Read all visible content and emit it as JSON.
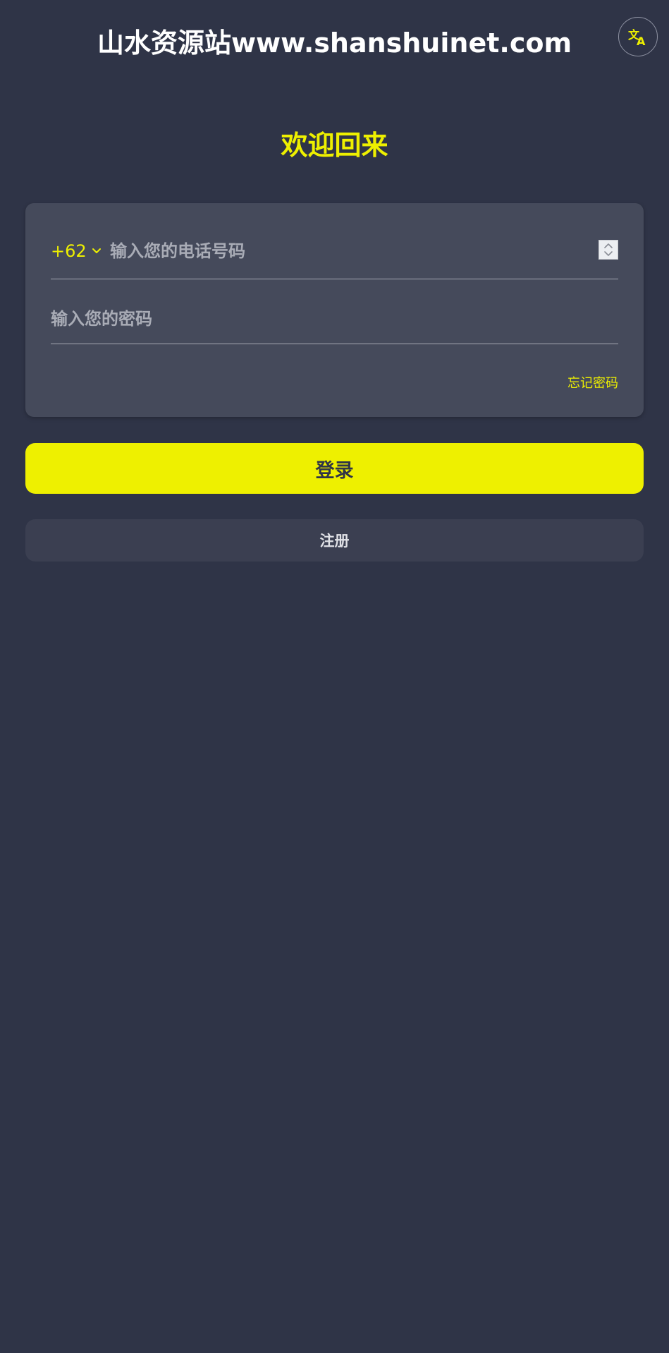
{
  "header": {
    "site_title": "山水资源站www.shanshuinet.com",
    "language_icon": "translate-icon"
  },
  "welcome": "欢迎回来",
  "form": {
    "country_code": "+62",
    "phone_placeholder": "输入您的电话号码",
    "password_placeholder": "输入您的密码",
    "forgot_password": "忘记密码"
  },
  "actions": {
    "login_label": "登录",
    "register_label": "注册"
  },
  "colors": {
    "background": "#2f3447",
    "card": "#454a5b",
    "accent": "#eef000"
  }
}
